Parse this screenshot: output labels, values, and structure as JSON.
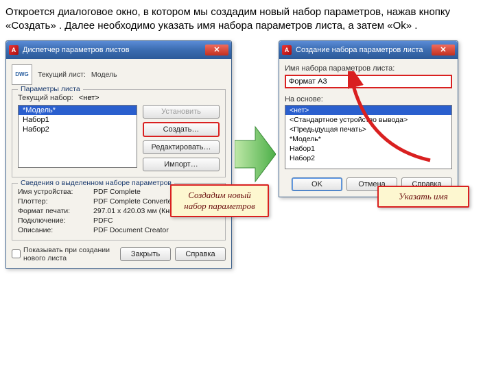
{
  "caption": "Откроется диалоговое окно, в котором мы создадим новый набор параметров, нажав кнопку «Создать» . Далее необходимо указать имя набора параметров листа, а затем «Ok» .",
  "dlg1": {
    "title": "Диспетчер параметров листов",
    "cur_label": "Текущий лист:",
    "cur_value": "Модель",
    "group_params": "Параметры листа",
    "cur_set_label": "Текущий набор:",
    "cur_set_value": "<нет>",
    "items": [
      "*Модель*",
      "Набор1",
      "Набор2"
    ],
    "btn_set": "Установить",
    "btn_new": "Создать…",
    "btn_edit": "Редактировать…",
    "btn_import": "Импорт…",
    "group_info": "Сведения о выделенном наборе параметров",
    "info": {
      "device_l": "Имя устройства:",
      "device_v": "PDF Complete",
      "plotter_l": "Плоттер:",
      "plotter_v": "PDF Complete Converter",
      "format_l": "Формат печати:",
      "format_v": "297.01 x 420.03 мм (Книжная)",
      "conn_l": "Подключение:",
      "conn_v": "PDFC",
      "desc_l": "Описание:",
      "desc_v": "PDF Document Creator"
    },
    "checkbox": "Показывать при создании нового листа",
    "btn_close": "Закрыть",
    "btn_help": "Справка"
  },
  "dlg2": {
    "title": "Создание набора параметров листа",
    "name_label": "Имя набора параметров листа:",
    "name_value": "Формат А3",
    "based_label": "На основе:",
    "based_items": [
      "<нет>",
      "<Стандартное устройство вывода>",
      "<Предыдущая печать>",
      "*Модель*",
      "Набор1",
      "Набор2"
    ],
    "btn_ok": "OK",
    "btn_cancel": "Отмена",
    "btn_help": "Справка"
  },
  "note1": "Создадим новый набор параметров",
  "note2": "Указать имя"
}
